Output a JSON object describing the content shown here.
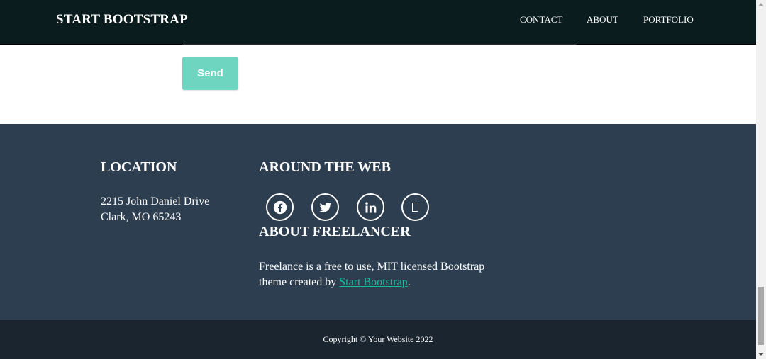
{
  "navbar": {
    "brand": "START BOOTSTRAP",
    "links": [
      "CONTACT",
      "ABOUT",
      "PORTFOLIO"
    ]
  },
  "form": {
    "send_label": "Send"
  },
  "footer": {
    "location": {
      "title": "LOCATION",
      "line1": "2215 John Daniel Drive",
      "line2": "Clark, MO 65243"
    },
    "around_web": {
      "title": "AROUND THE WEB",
      "icons": [
        "facebook-icon",
        "twitter-icon",
        "linkedin-icon",
        "dribbble-icon"
      ]
    },
    "about": {
      "title": "ABOUT FREELANCER",
      "text_before": "Freelance is a free to use, MIT licensed Bootstrap theme created by ",
      "link_text": "Start Bootstrap",
      "text_after": "."
    }
  },
  "copyright": "Copyright © Your Website 2022",
  "colors": {
    "navbar_bg": "#0b1c1e",
    "footer_bg": "#2d3e50",
    "copyright_bg": "#1a252f",
    "accent": "#1abc9c",
    "send_button": "#6dd5c0"
  }
}
